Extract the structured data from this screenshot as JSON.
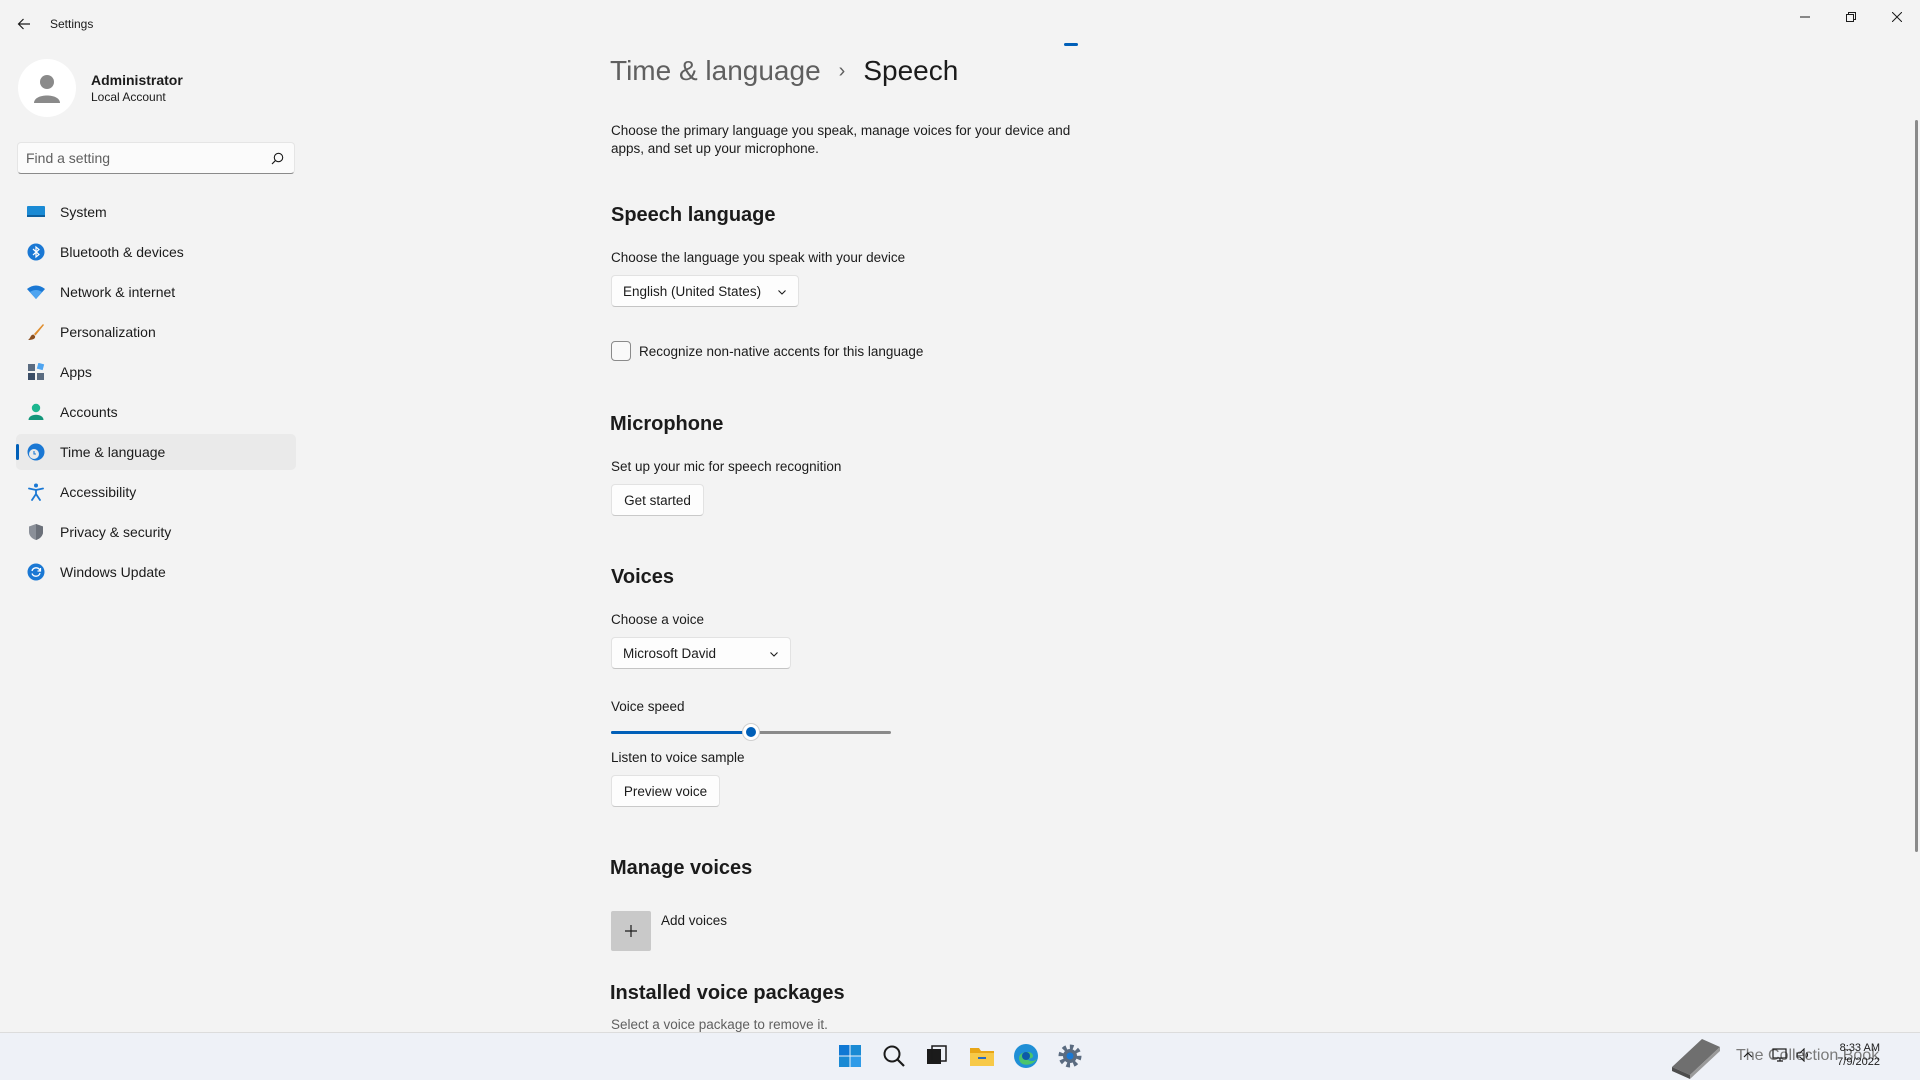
{
  "window": {
    "title": "Settings",
    "controls": {
      "minimize": "minimize",
      "maximize": "restore",
      "close": "close"
    }
  },
  "profile": {
    "name": "Administrator",
    "account_type": "Local Account"
  },
  "search": {
    "placeholder": "Find a setting"
  },
  "sidebar": {
    "items": [
      {
        "label": "System",
        "icon": "system-icon"
      },
      {
        "label": "Bluetooth & devices",
        "icon": "bluetooth-icon"
      },
      {
        "label": "Network & internet",
        "icon": "wifi-icon"
      },
      {
        "label": "Personalization",
        "icon": "brush-icon"
      },
      {
        "label": "Apps",
        "icon": "apps-icon"
      },
      {
        "label": "Accounts",
        "icon": "person-icon"
      },
      {
        "label": "Time & language",
        "icon": "globe-clock-icon",
        "active": true
      },
      {
        "label": "Accessibility",
        "icon": "accessibility-icon"
      },
      {
        "label": "Privacy & security",
        "icon": "shield-icon"
      },
      {
        "label": "Windows Update",
        "icon": "update-icon"
      }
    ]
  },
  "breadcrumb": {
    "parent": "Time & language",
    "separator": "›",
    "current": "Speech"
  },
  "main": {
    "description": "Choose the primary language you speak, manage voices for your device and apps, and set up your microphone.",
    "speech_language": {
      "heading": "Speech language",
      "label": "Choose the language you speak with your device",
      "selected": "English (United States)",
      "checkbox_label": "Recognize non-native accents for this language",
      "checkbox_checked": false
    },
    "microphone": {
      "heading": "Microphone",
      "label": "Set up your mic for speech recognition",
      "button": "Get started"
    },
    "voices": {
      "heading": "Voices",
      "choose_label": "Choose a voice",
      "selected_voice": "Microsoft David",
      "speed_label": "Voice speed",
      "speed_fraction": 0.5,
      "sample_label": "Listen to voice sample",
      "preview_button": "Preview voice"
    },
    "manage_voices": {
      "heading": "Manage voices",
      "add_label": "Add voices",
      "add_symbol": "+"
    },
    "installed": {
      "heading": "Installed voice packages",
      "label": "Select a voice package to remove it."
    }
  },
  "taskbar": {
    "apps": [
      "start-icon",
      "search-icon",
      "task-view-icon",
      "file-explorer-icon",
      "edge-icon",
      "settings-icon"
    ],
    "active_app": "settings-icon",
    "watermark": "The Collection Book",
    "tray": [
      "chevron-up-icon",
      "network-icon",
      "volume-icon"
    ],
    "time": "8:33 AM",
    "date": "7/9/2022"
  },
  "colors": {
    "accent": "#005fb8",
    "background": "#f3f3f3",
    "selected": "#eaeaea"
  }
}
